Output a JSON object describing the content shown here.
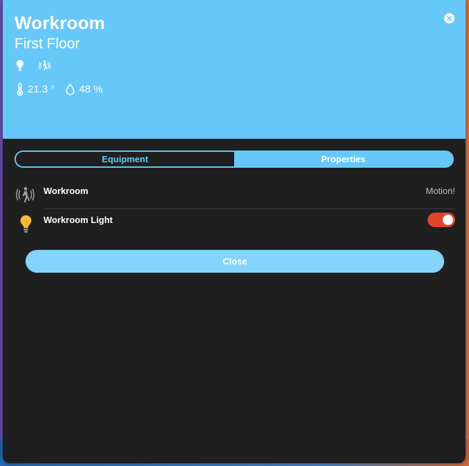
{
  "header": {
    "title": "Workroom",
    "subtitle": "First Floor",
    "temperature": "21.3 °",
    "humidity": "48 %",
    "icons": [
      "lightbulb-icon",
      "motion-sensor-icon",
      "thermometer-icon",
      "droplet-icon",
      "close-icon"
    ]
  },
  "tabs": [
    {
      "label": "Equipment",
      "active": true
    },
    {
      "label": "Properties",
      "active": false
    }
  ],
  "equipment": [
    {
      "name": "Workroom",
      "icon": "motion-sensor-icon",
      "status": "Motion!"
    },
    {
      "name": "Workroom Light",
      "icon": "lightbulb-icon",
      "toggle_on": true
    }
  ],
  "colors": {
    "header": "#66c8f8",
    "panel": "#1f1f1f",
    "toggle_on": "#e0452a",
    "bulb": "#f9b93a",
    "close_button": "#84d3fa"
  },
  "footer": {
    "close_label": "Close"
  }
}
